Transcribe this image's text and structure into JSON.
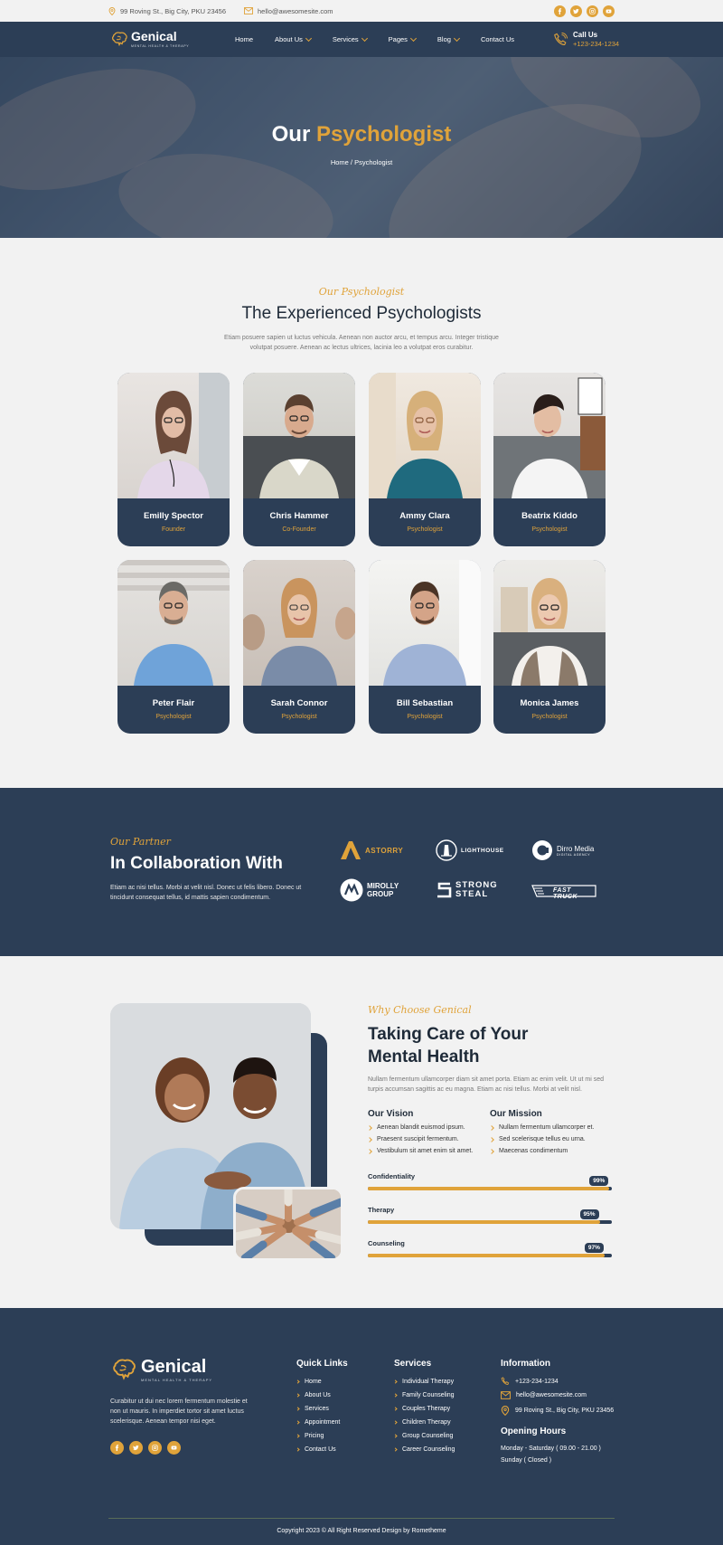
{
  "topbar": {
    "address": "99 Roving St., Big City, PKU 23456",
    "email": "hello@awesomesite.com",
    "socials": [
      "facebook-icon",
      "twitter-icon",
      "instagram-icon",
      "youtube-icon"
    ]
  },
  "brand": {
    "name": "Genical",
    "tagline": "MENTAL HEALTH & THERAPY",
    "accent": "#e0a33a",
    "navy": "#2c3e56"
  },
  "nav": {
    "items": [
      {
        "label": "Home",
        "dropdown": false
      },
      {
        "label": "About Us",
        "dropdown": true
      },
      {
        "label": "Services",
        "dropdown": true
      },
      {
        "label": "Pages",
        "dropdown": true
      },
      {
        "label": "Blog",
        "dropdown": true
      },
      {
        "label": "Contact Us",
        "dropdown": false
      }
    ],
    "call_label": "Call Us",
    "call_number": "+123-234-1234"
  },
  "hero": {
    "title_plain": "Our",
    "title_accent": "Psychologist",
    "breadcrumb": "Home / Psychologist"
  },
  "team": {
    "tag": "Our Psychologist",
    "title": "The Experienced Psychologists",
    "desc_line1": "Etiam posuere sapien ut luctus vehicula. Aenean non auctor arcu, et tempus arcu. Integer tristique",
    "desc_line2": "volutpat posuere. Aenean ac lectus ultrices, lacinia leo a volutpat eros curabitur.",
    "members": [
      {
        "name": "Emilly Spector",
        "role": "Founder"
      },
      {
        "name": "Chris Hammer",
        "role": "Co-Founder"
      },
      {
        "name": "Ammy Clara",
        "role": "Psychologist"
      },
      {
        "name": "Beatrix Kiddo",
        "role": "Psychologist"
      },
      {
        "name": "Peter Flair",
        "role": "Psychologist"
      },
      {
        "name": "Sarah Connor",
        "role": "Psychologist"
      },
      {
        "name": "Bill Sebastian",
        "role": "Psychologist"
      },
      {
        "name": "Monica James",
        "role": "Psychologist"
      }
    ]
  },
  "partners": {
    "tag": "Our Partner",
    "title": "In Collaboration With",
    "desc": "Etiam ac nisi tellus. Morbi at velit nisl. Donec ut felis libero. Donec ut tincidunt consequat tellus, id mattis sapien condimentum.",
    "logos": [
      {
        "name": "ASTORRY"
      },
      {
        "name": "LIGHTHOUSE"
      },
      {
        "name": "Dirro Media",
        "sub": "DIGITAL AGENCY"
      },
      {
        "name": "MIROLLY",
        "sub": "GROUP"
      },
      {
        "name": "STRONG",
        "sub": "STEAL"
      },
      {
        "name": "FAST TRUCK"
      }
    ]
  },
  "why": {
    "tag": "Why Choose Genical",
    "title_line1": "Taking Care of Your",
    "title_line2": "Mental Health",
    "desc": "Nullam fermentum ullamcorper diam sit amet porta. Etiam ac enim velit. Ut ut mi sed turpis accumsan sagittis ac eu magna. Etiam ac nisi tellus. Morbi at velit nisl.",
    "vision_title": "Our Vision",
    "vision_items": [
      "Aenean blandit euismod ipsum.",
      "Praesent suscipit fermentum.",
      "Vestibulum sit amet enim sit amet."
    ],
    "mission_title": "Our Mission",
    "mission_items": [
      "Nullam fermentum ullamcorper et.",
      "Sed scelerisque tellus eu urna.",
      "Maecenas condimentum"
    ],
    "skills": [
      {
        "label": "Confidentiality",
        "value": 99,
        "text": "99%"
      },
      {
        "label": "Therapy",
        "value": 95,
        "text": "95%"
      },
      {
        "label": "Counseling",
        "value": 97,
        "text": "97%"
      }
    ]
  },
  "footer": {
    "about": "Curabitur ut dui nec lorem fermentum molestie  et non ut mauris. In imperdiet tortor sit amet luctus scelerisque. Aenean tempor nisi eget.",
    "quick_title": "Quick Links",
    "quick_links": [
      "Home",
      "About Us",
      "Services",
      "Appointment",
      "Pricing",
      "Contact Us"
    ],
    "services_title": "Services",
    "services": [
      "Individual Therapy",
      "Family Counseling",
      "Couples Therapy",
      "Children Therapy",
      "Group Counseling",
      "Career Counseling"
    ],
    "info_title": "Information",
    "phone": "+123-234-1234",
    "email": "hello@awesomesite.com",
    "address": "99 Roving St., Big City, PKU 23456",
    "hours_title": "Opening Hours",
    "hours_line1": "Monday - Saturday ( 09.00 - 21.00 )",
    "hours_line2": "Sunday ( Closed )",
    "copyright": "Copyright 2023 © All Right Reserved Design by Rometheme"
  }
}
